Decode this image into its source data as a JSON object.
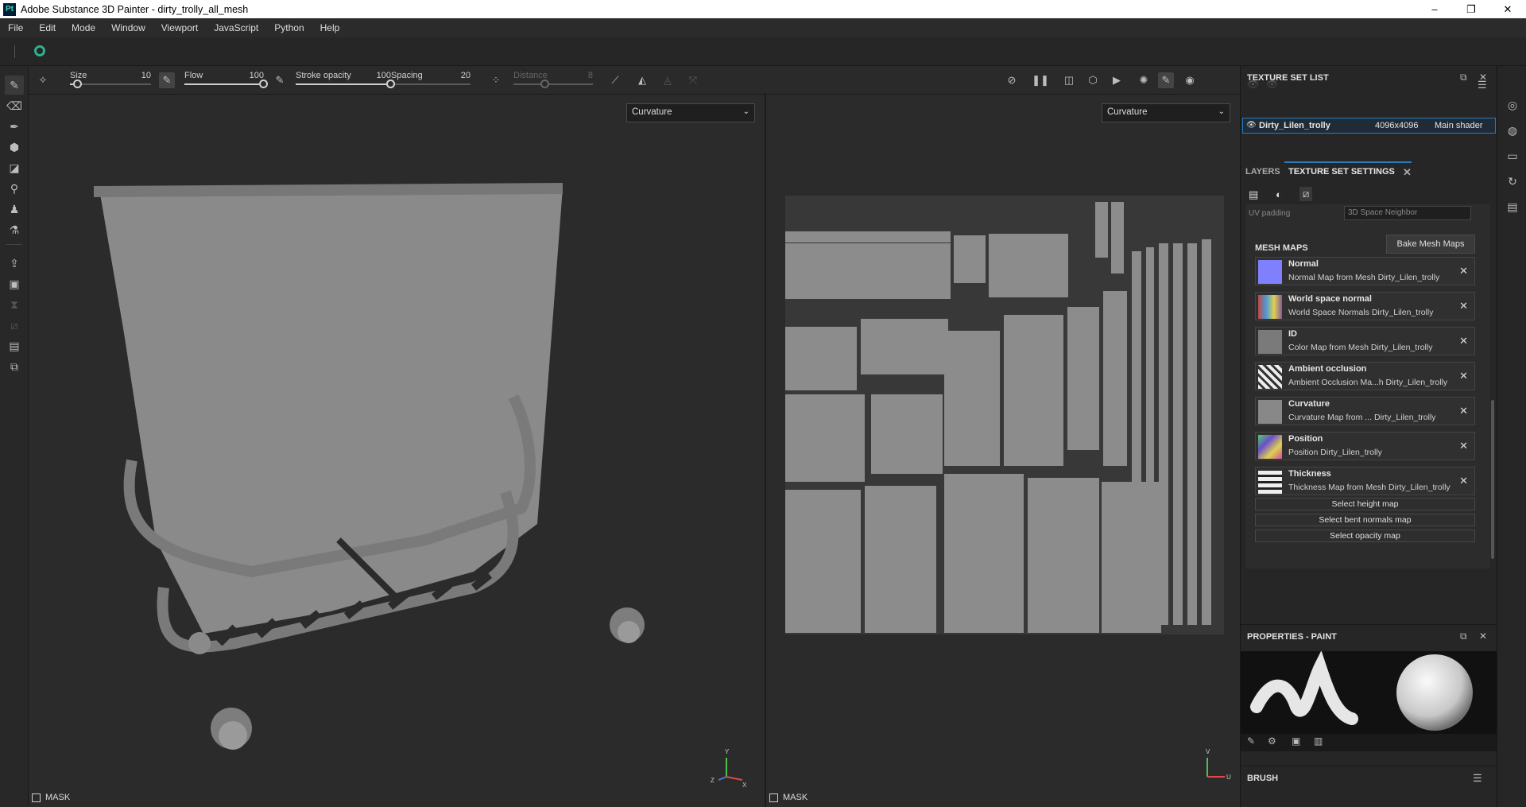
{
  "window": {
    "title": "Adobe Substance 3D Painter - dirty_trolly_all_mesh",
    "app_icon": "Pt",
    "controls": [
      "–",
      "❐",
      "✕"
    ]
  },
  "menu": [
    "File",
    "Edit",
    "Mode",
    "Window",
    "Viewport",
    "JavaScript",
    "Python",
    "Help"
  ],
  "toolbar": {
    "size": {
      "label": "Size",
      "value": "10",
      "fraction": 0.1
    },
    "flow": {
      "label": "Flow",
      "value": "100",
      "fraction": 1.0
    },
    "stroke_opacity": {
      "label": "Stroke opacity",
      "value": "100",
      "fraction": 1.0
    },
    "spacing": {
      "label": "Spacing",
      "value": "20",
      "fraction": 0.0
    },
    "distance": {
      "label": "Distance",
      "value": "8",
      "fraction": 0.4
    }
  },
  "viewport3d": {
    "channel": "Curvature",
    "mask_label": "MASK"
  },
  "viewport2d": {
    "channel": "Curvature",
    "mask_label": "MASK"
  },
  "axes": {
    "y": "Y",
    "x": "X",
    "z": "Z",
    "u": "U",
    "v": "V"
  },
  "texture_set_list": {
    "title": "TEXTURE SET LIST",
    "row": {
      "name": "Dirty_Lilen_trolly",
      "resolution": "4096x4096",
      "shader": "Main shader"
    }
  },
  "tabs": {
    "layers": "LAYERS",
    "texture_set_settings": "TEXTURE SET SETTINGS"
  },
  "uv_padding": {
    "label": "UV padding",
    "value": "3D Space Neighbor"
  },
  "mesh_maps": {
    "title": "MESH MAPS",
    "bake_button": "Bake Mesh Maps",
    "items": [
      {
        "name": "Normal",
        "desc": "Normal Map from Mesh Dirty_Lilen_trolly",
        "color": "#8080ff"
      },
      {
        "name": "World space normal",
        "desc": "World Space Normals Dirty_Lilen_trolly",
        "color": "#8a5a9a"
      },
      {
        "name": "ID",
        "desc": "Color Map from Mesh Dirty_Lilen_trolly",
        "color": "#7a7a7a"
      },
      {
        "name": "Ambient occlusion",
        "desc": "Ambient Occlusion Ma...h Dirty_Lilen_trolly",
        "color": "#d8d8d8"
      },
      {
        "name": "Curvature",
        "desc": "Curvature Map from ... Dirty_Lilen_trolly",
        "color": "#888888"
      },
      {
        "name": "Position",
        "desc": "Position Dirty_Lilen_trolly",
        "color": "#6a4fc8"
      },
      {
        "name": "Thickness",
        "desc": "Thickness Map from Mesh Dirty_Lilen_trolly",
        "color": "#e8e8e8"
      }
    ],
    "select_buttons": [
      "Select height map",
      "Select bent normals map",
      "Select opacity map"
    ]
  },
  "properties": {
    "title": "PROPERTIES - PAINT",
    "brush_section": "BRUSH"
  }
}
